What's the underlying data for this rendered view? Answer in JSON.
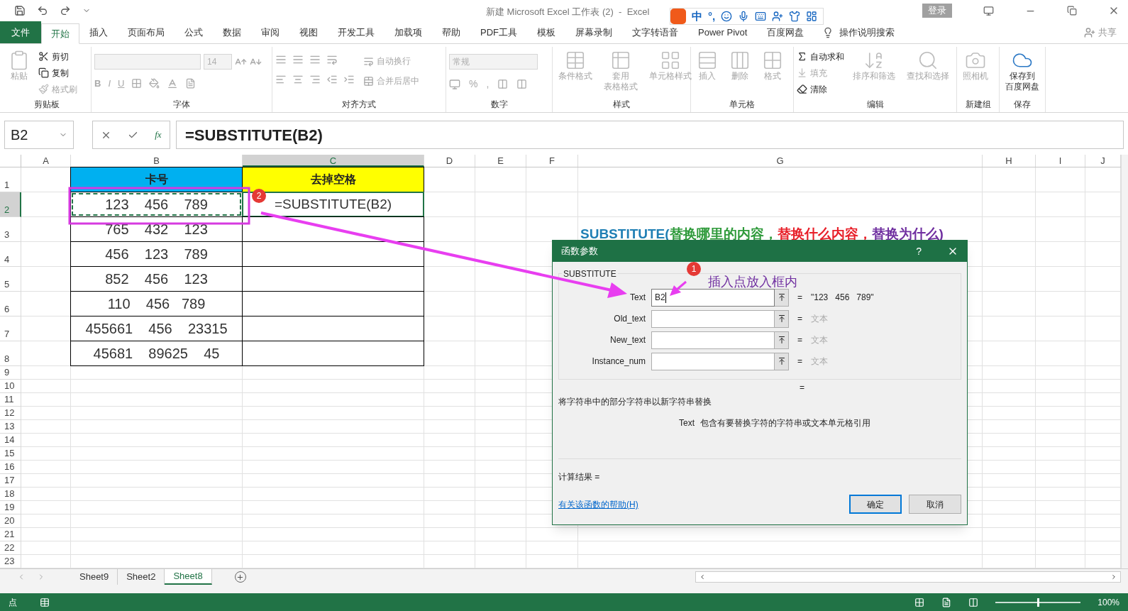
{
  "title_bar": {
    "title": "新建 Microsoft Excel 工作表 (2)  -  Excel",
    "login": "登录"
  },
  "ime_toolbar": {
    "items": [
      "中",
      "°,"
    ]
  },
  "menu": {
    "tabs": [
      {
        "label": "文件",
        "kind": "file",
        "selected": false
      },
      {
        "label": "开始",
        "kind": "tab",
        "selected": true
      },
      {
        "label": "插入",
        "kind": "tab",
        "selected": false
      },
      {
        "label": "页面布局",
        "kind": "tab",
        "selected": false
      },
      {
        "label": "公式",
        "kind": "tab",
        "selected": false
      },
      {
        "label": "数据",
        "kind": "tab",
        "selected": false
      },
      {
        "label": "审阅",
        "kind": "tab",
        "selected": false
      },
      {
        "label": "视图",
        "kind": "tab",
        "selected": false
      },
      {
        "label": "开发工具",
        "kind": "tab",
        "selected": false
      },
      {
        "label": "加载项",
        "kind": "tab",
        "selected": false
      },
      {
        "label": "帮助",
        "kind": "tab",
        "selected": false
      },
      {
        "label": "PDF工具",
        "kind": "tab",
        "selected": false
      },
      {
        "label": "模板",
        "kind": "tab",
        "selected": false
      },
      {
        "label": "屏幕录制",
        "kind": "tab",
        "selected": false
      },
      {
        "label": "文字转语音",
        "kind": "tab",
        "selected": false
      },
      {
        "label": "Power Pivot",
        "kind": "tab",
        "selected": false
      },
      {
        "label": "百度网盘",
        "kind": "tab",
        "selected": false
      }
    ],
    "search": "操作说明搜索",
    "share": "共享"
  },
  "ribbon": {
    "groups": [
      {
        "label": "剪贴板",
        "kind": "buttons",
        "buttons": [
          {
            "label": "粘贴",
            "kind": "large",
            "disabled": true
          },
          {
            "label": "剪切",
            "kind": "small",
            "disabled": false
          },
          {
            "label": "复制",
            "kind": "small",
            "disabled": false
          },
          {
            "label": "格式刷",
            "kind": "small",
            "disabled": true
          }
        ]
      },
      {
        "label": "字体",
        "kind": "font",
        "font_size": "14",
        "buttons": [
          {
            "label": "B"
          },
          {
            "label": "I"
          },
          {
            "label": "U"
          }
        ]
      },
      {
        "label": "对齐方式",
        "kind": "align",
        "buttons": [
          {
            "label": "自动换行",
            "disabled": true
          },
          {
            "label": "合并后居中",
            "disabled": true
          }
        ]
      },
      {
        "label": "数字",
        "kind": "number",
        "format": "常规",
        "buttons": [
          {
            "label": "%"
          },
          {
            "label": ","
          }
        ]
      },
      {
        "label": "样式",
        "kind": "buttons",
        "buttons": [
          {
            "label": "条件格式",
            "kind": "large",
            "disabled": true
          },
          {
            "label": "套用",
            "label_line_2": "表格格式",
            "kind": "large",
            "disabled": true
          },
          {
            "label": "单元格样式",
            "kind": "large",
            "disabled": true
          }
        ]
      },
      {
        "label": "单元格",
        "kind": "buttons",
        "buttons": [
          {
            "label": "插入",
            "kind": "large",
            "disabled": true
          },
          {
            "label": "删除",
            "kind": "large",
            "disabled": true
          },
          {
            "label": "格式",
            "kind": "large",
            "disabled": true
          }
        ]
      },
      {
        "label": "编辑",
        "kind": "buttons",
        "buttons": [
          {
            "label": "自动求和",
            "kind": "small",
            "disabled": false
          },
          {
            "label": "填充",
            "kind": "small",
            "disabled": true
          },
          {
            "label": "清除",
            "kind": "small",
            "disabled": false
          },
          {
            "label": "排序和筛选",
            "kind": "large",
            "disabled": true
          },
          {
            "label": "查找和选择",
            "kind": "large",
            "disabled": true
          }
        ]
      },
      {
        "label": "新建组",
        "kind": "buttons",
        "buttons": [
          {
            "label": "照相机",
            "kind": "large",
            "disabled": true
          }
        ]
      },
      {
        "label": "保存",
        "kind": "buttons",
        "buttons": [
          {
            "label": "保存到",
            "label_line_2": "百度网盘",
            "kind": "large",
            "disabled": false
          }
        ]
      }
    ]
  },
  "formula_bar": {
    "name_box": "B2",
    "function_button": "fx",
    "formula": "=SUBSTITUTE(B2)"
  },
  "sheet": {
    "columns": [
      {
        "label": "A",
        "selected": false
      },
      {
        "label": "B",
        "selected": false
      },
      {
        "label": "C",
        "selected": true
      },
      {
        "label": "D",
        "selected": false
      },
      {
        "label": "E",
        "selected": false
      },
      {
        "label": "F",
        "selected": false
      },
      {
        "label": "G",
        "selected": false
      },
      {
        "label": "H",
        "selected": false
      },
      {
        "label": "I",
        "selected": false
      },
      {
        "label": "J",
        "selected": false
      }
    ],
    "rows": [
      {
        "label": "1",
        "selected": false,
        "cells": [
          {
            "text": "卡号",
            "kind": "header",
            "color": "#00b0f0"
          },
          {
            "text": "去掉空格",
            "kind": "header",
            "color": "#ffff00"
          }
        ]
      },
      {
        "label": "2",
        "selected": true,
        "cells": [
          {
            "text": "123    456    789",
            "kind": "copying"
          },
          {
            "text": "=SUBSTITUTE(B2)",
            "kind": "active"
          }
        ]
      },
      {
        "label": "3",
        "selected": false,
        "cells": [
          {
            "text": "765    432    123",
            "kind": "normal"
          },
          {
            "kind": "normal"
          }
        ]
      },
      {
        "label": "4",
        "selected": false,
        "cells": [
          {
            "text": "456    123    789",
            "kind": "normal"
          },
          {
            "kind": "normal"
          }
        ]
      },
      {
        "label": "5",
        "selected": false,
        "cells": [
          {
            "text": "852    456    123",
            "kind": "normal"
          },
          {
            "kind": "normal"
          }
        ]
      },
      {
        "label": "6",
        "selected": false,
        "cells": [
          {
            "text": "110    456   789",
            "kind": "normal"
          },
          {
            "kind": "normal"
          }
        ]
      },
      {
        "label": "7",
        "selected": false,
        "cells": [
          {
            "text": "455661    456    23315",
            "kind": "normal"
          },
          {
            "kind": "normal"
          }
        ]
      },
      {
        "label": "8",
        "selected": false,
        "cells": [
          {
            "text": "45681    89625    45",
            "kind": "normal"
          },
          {
            "kind": "normal"
          }
        ]
      },
      {
        "label": "9",
        "selected": false
      },
      {
        "label": "10",
        "selected": false
      },
      {
        "label": "11",
        "selected": false
      },
      {
        "label": "12",
        "selected": false
      },
      {
        "label": "13",
        "selected": false
      },
      {
        "label": "14",
        "selected": false
      },
      {
        "label": "15",
        "selected": false
      },
      {
        "label": "16",
        "selected": false
      },
      {
        "label": "17",
        "selected": false
      },
      {
        "label": "18",
        "selected": false
      },
      {
        "label": "19",
        "selected": false
      },
      {
        "label": "20",
        "selected": false
      },
      {
        "label": "21",
        "selected": false
      },
      {
        "label": "22",
        "selected": false
      },
      {
        "label": "23",
        "selected": false
      }
    ],
    "note": [
      {
        "text": "SUBSTITUTE(",
        "color": "#1f7fb4"
      },
      {
        "text": "替换哪里的内容，",
        "color": "#2e9a3a"
      },
      {
        "text": "替换什么内容，",
        "color": "#e8202a"
      },
      {
        "text": "替换为什么)",
        "color": "#7030a0"
      }
    ]
  },
  "annotations": {
    "badges": [
      "2",
      "1"
    ],
    "callout": "插入点放入框内"
  },
  "dialog": {
    "title": "函数参数",
    "help": "?",
    "function": "SUBSTITUTE",
    "args": [
      {
        "label": "Text",
        "value": "B2",
        "focused": true,
        "sign": "=",
        "result": "\"123   456   789\""
      },
      {
        "label": "Old_text",
        "focused": false,
        "sign": "=",
        "result": "文本"
      },
      {
        "label": "New_text",
        "focused": false,
        "sign": "=",
        "result": "文本"
      },
      {
        "label": "Instance_num",
        "focused": false,
        "sign": "=",
        "result": "文本"
      }
    ],
    "equals": "=",
    "description": "将字符串中的部分字符串以新字符串替换",
    "arg_name": "Text",
    "arg_help": "包含有要替换字符的字符串或文本单元格引用",
    "result_label": "计算结果 =",
    "help_link": "有关该函数的帮助(H)",
    "ok": "确定",
    "cancel": "取消"
  },
  "sheet_tabs": [
    {
      "label": "Sheet9",
      "selected": false
    },
    {
      "label": "Sheet2",
      "selected": false
    },
    {
      "label": "Sheet8",
      "selected": true
    }
  ],
  "status_bar": {
    "mode": "点",
    "zoom_slider": {
      "level": 0.5
    },
    "zoom": "100%"
  }
}
